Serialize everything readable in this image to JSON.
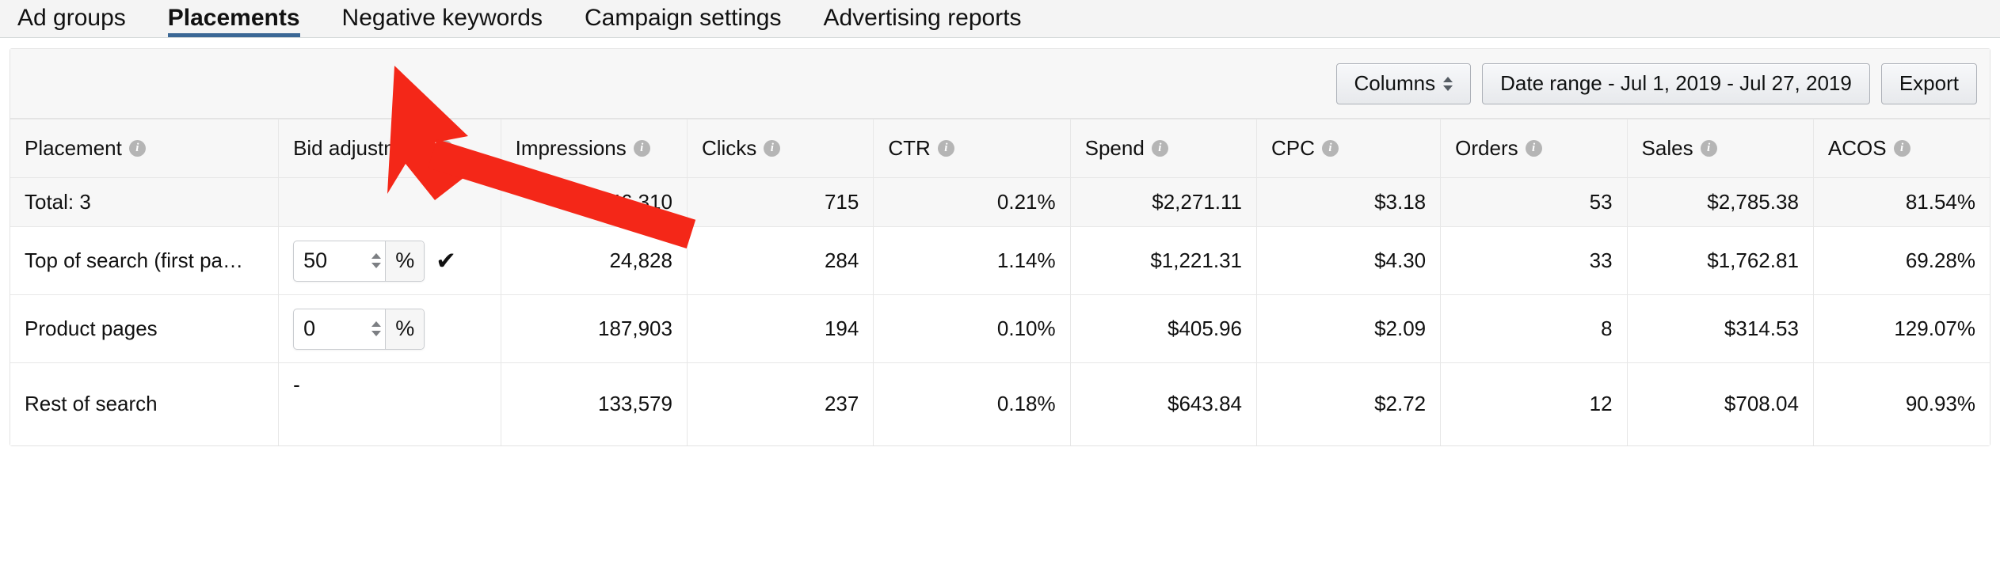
{
  "tabs": [
    {
      "label": "Ad groups",
      "active": false
    },
    {
      "label": "Placements",
      "active": true
    },
    {
      "label": "Negative keywords",
      "active": false
    },
    {
      "label": "Campaign settings",
      "active": false
    },
    {
      "label": "Advertising reports",
      "active": false
    }
  ],
  "toolbar": {
    "columns_label": "Columns",
    "date_range_label": "Date range - Jul 1, 2019 - Jul 27, 2019",
    "export_label": "Export"
  },
  "table": {
    "headers": [
      "Placement",
      "Bid adjustment",
      "Impressions",
      "Clicks",
      "CTR",
      "Spend",
      "CPC",
      "Orders",
      "Sales",
      "ACOS"
    ],
    "info_glyph": "i",
    "total_row": {
      "label": "Total: 3",
      "bid_adjustment": "",
      "impressions": "346,310",
      "clicks": "715",
      "ctr": "0.21%",
      "spend": "$2,271.11",
      "cpc": "$3.18",
      "orders": "53",
      "sales": "$2,785.38",
      "acos": "81.54%"
    },
    "rows": [
      {
        "placement": "Top of search (first pa…",
        "bid_type": "input",
        "bid_value": "50",
        "bid_unit": "%",
        "has_check": true,
        "check_glyph": "✔",
        "impressions": "24,828",
        "clicks": "284",
        "ctr": "1.14%",
        "spend": "$1,221.31",
        "cpc": "$4.30",
        "orders": "33",
        "sales": "$1,762.81",
        "acos": "69.28%"
      },
      {
        "placement": "Product pages",
        "bid_type": "input",
        "bid_value": "0",
        "bid_unit": "%",
        "has_check": false,
        "check_glyph": "",
        "impressions": "187,903",
        "clicks": "194",
        "ctr": "0.10%",
        "spend": "$405.96",
        "cpc": "$2.09",
        "orders": "8",
        "sales": "$314.53",
        "acos": "129.07%"
      },
      {
        "placement": "Rest of search",
        "bid_type": "dash",
        "bid_value": "-",
        "bid_unit": "",
        "has_check": false,
        "check_glyph": "",
        "impressions": "133,579",
        "clicks": "237",
        "ctr": "0.18%",
        "spend": "$643.84",
        "cpc": "$2.72",
        "orders": "12",
        "sales": "$708.04",
        "acos": "90.93%"
      }
    ]
  },
  "annotation": {
    "type": "arrow",
    "color": "#f42718",
    "points_to": "Placements"
  },
  "colors": {
    "active_tab_underline": "#3b6795",
    "tabbar_background": "#f4f4f4",
    "toolbar_background": "#f7f7f7",
    "border": "#e3e3e3",
    "text": "#111111",
    "annotation_red": "#f42718"
  }
}
